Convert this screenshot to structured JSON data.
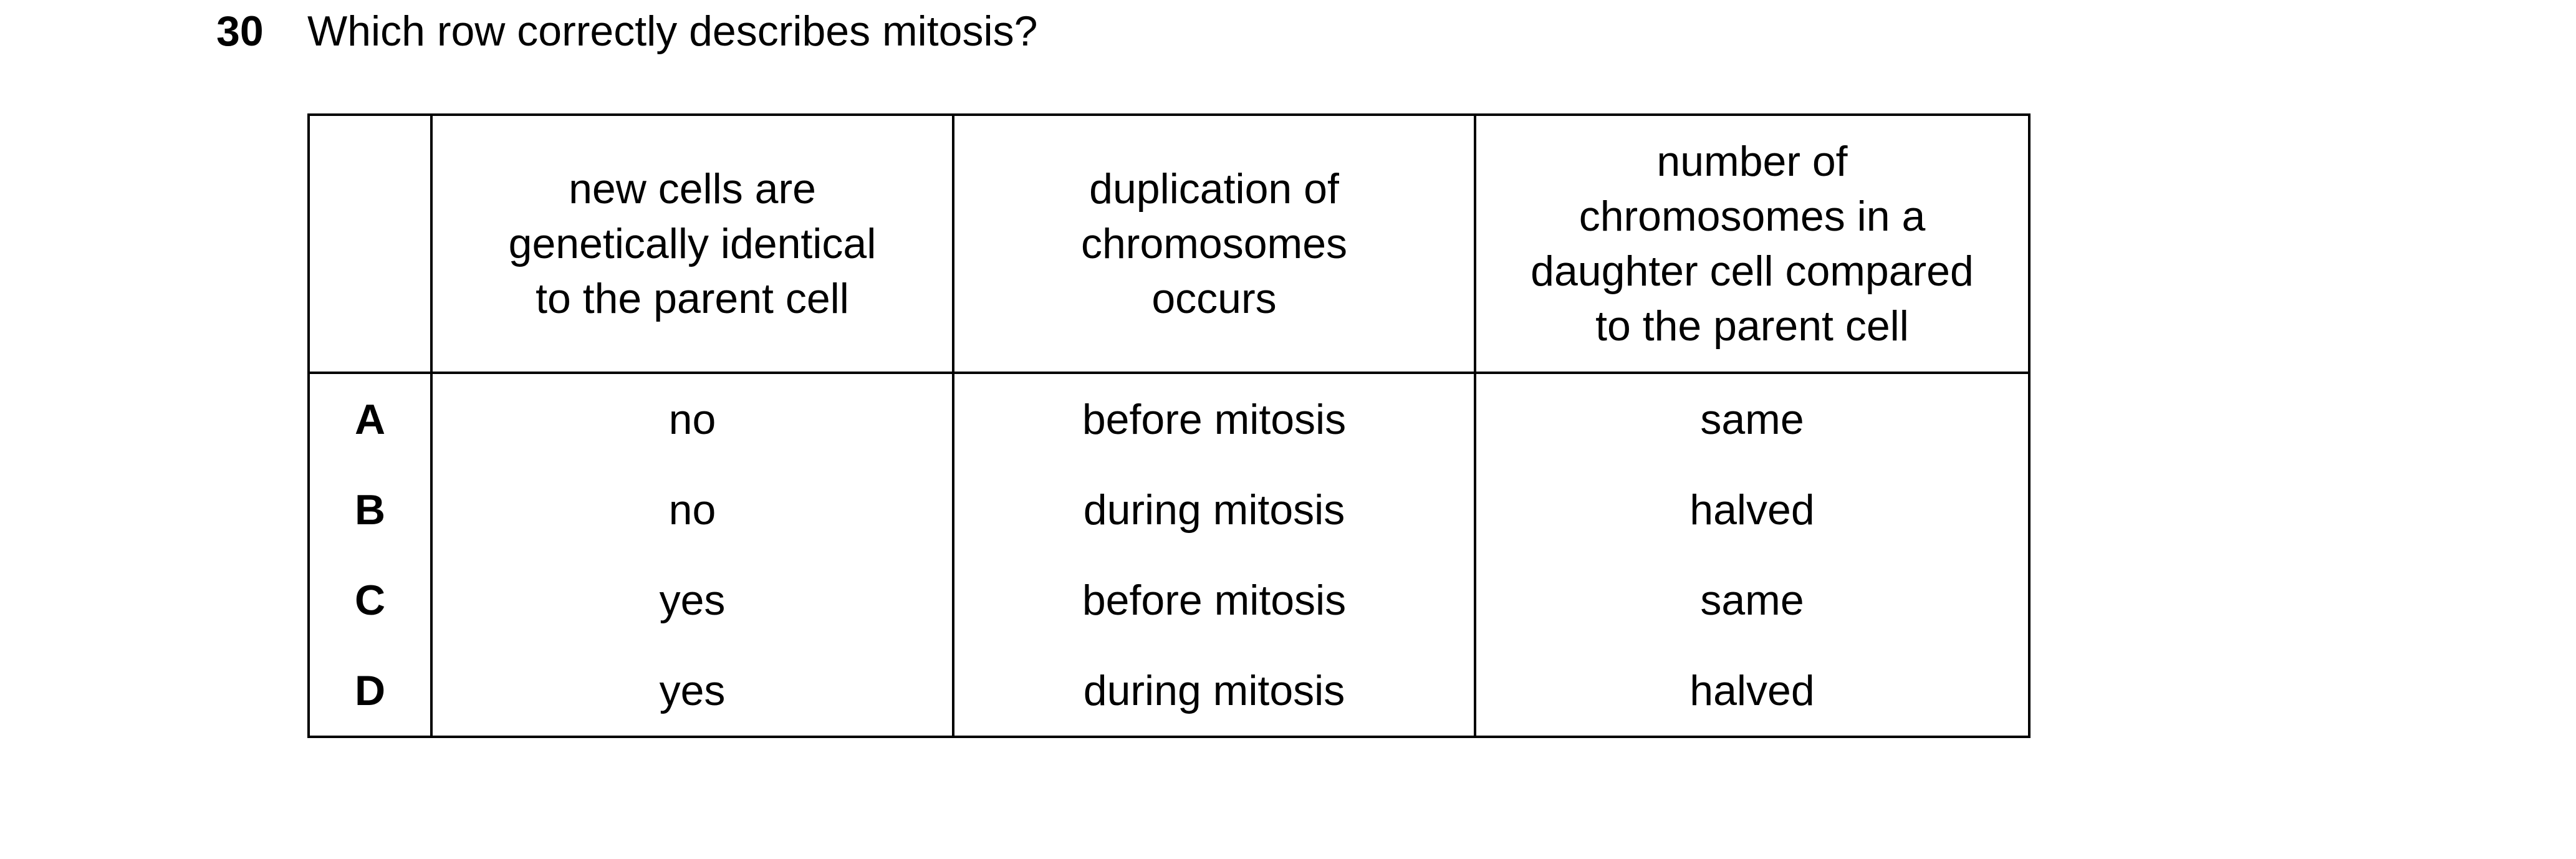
{
  "question": {
    "number": "30",
    "text": "Which row correctly describes mitosis?"
  },
  "table": {
    "headers": [
      "",
      [
        "new cells are",
        "genetically identical",
        "to the parent cell"
      ],
      [
        "duplication of",
        "chromosomes",
        "occurs"
      ],
      [
        "number of",
        "chromosomes in a",
        "daughter cell compared",
        "to the parent cell"
      ]
    ],
    "rows": [
      {
        "letter": "A",
        "cells": [
          "no",
          "before mitosis",
          "same"
        ]
      },
      {
        "letter": "B",
        "cells": [
          "no",
          "during mitosis",
          "halved"
        ]
      },
      {
        "letter": "C",
        "cells": [
          "yes",
          "before mitosis",
          "same"
        ]
      },
      {
        "letter": "D",
        "cells": [
          "yes",
          "during mitosis",
          "halved"
        ]
      }
    ]
  }
}
